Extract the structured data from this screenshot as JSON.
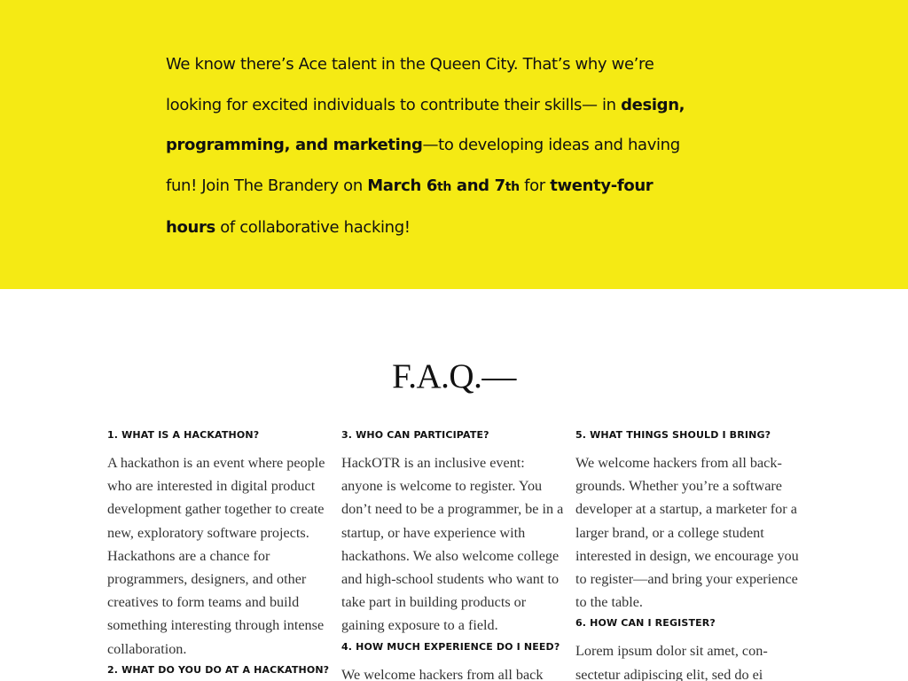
{
  "hero": {
    "intro_1": "We know there’s Ace talent in the Queen City. That’s why we’re looking for excited individuals to contribute their skills— in ",
    "skills": "design, programming, and marketing",
    "intro_2": "—to developing ideas and having fun! Join The Brandery on ",
    "date_1": "March 6",
    "date_1_suffix": "th",
    "date_and": " and 7",
    "date_2_suffix": "th",
    "intro_3": " for ",
    "duration": "twenty-four hours",
    "intro_4": " of collaborative hacking!"
  },
  "faq": {
    "title": "F.A.Q.—",
    "columns": [
      {
        "items": [
          {
            "question": "1. What is a hackathon?",
            "answer": "A hackathon is an event where people who are interested in dig­ital product development gather together to create new, exploratory software projects. Hackathons are a chance for programmers, designers, and other creatives to form teams and build something interesting through intense collaboration."
          },
          {
            "question": "2. What do you do at a hackathon?",
            "answer": ""
          }
        ]
      },
      {
        "items": [
          {
            "question": "3. Who can participate?",
            "answer": "HackOTR is an inclusive event: anyone is welcome to register. You don’t need to be a programmer, be in a startup, or have experience with hackathons. We also welcome col­lege and high-school students who want to take part in building prod­ucts or gaining exposure to a field."
          },
          {
            "question": "4. How much experience do I need?",
            "answer": "We welcome hackers from all back"
          }
        ]
      },
      {
        "items": [
          {
            "question": "5. What things should I bring?",
            "answer": "We welcome hackers from all back­grounds. Whether you’re a software developer at a startup, a marketer for a larger brand, or a college stu­dent interested in design, we en­courage you to register—and bring your experience to the table."
          },
          {
            "question": "6. How can I register?",
            "answer": "Lorem ipsum dolor sit amet, con­sectetur adipiscing elit, sed do ei­"
          }
        ]
      }
    ]
  }
}
